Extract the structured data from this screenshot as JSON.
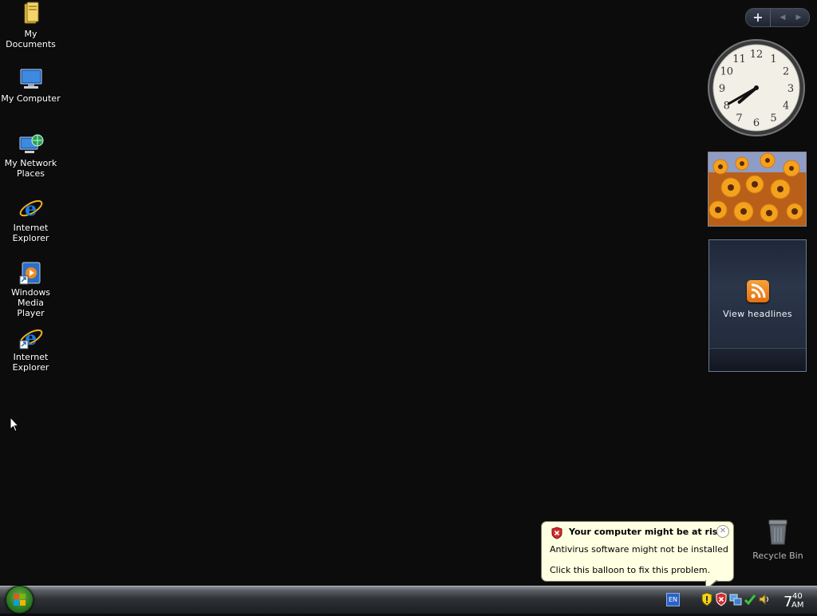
{
  "desktop_icons": [
    {
      "label_line1": "My Documents",
      "label_line2": "",
      "icon": "folder-icon"
    },
    {
      "label_line1": "My Computer",
      "label_line2": "",
      "icon": "computer-icon"
    },
    {
      "label_line1": "My Network",
      "label_line2": "Places",
      "icon": "network-places-icon"
    },
    {
      "label_line1": "Internet",
      "label_line2": "Explorer",
      "icon": "internet-explorer-icon"
    },
    {
      "label_line1": "Windows Media",
      "label_line2": "Player",
      "icon": "windows-media-player-icon"
    },
    {
      "label_line1": "Internet",
      "label_line2": "Explorer",
      "icon": "internet-explorer-shortcut-icon"
    }
  ],
  "sidebar": {
    "add_label": "+",
    "prev_label": "◀",
    "next_label": "▶",
    "clock": {
      "hour": 7,
      "minute": 40,
      "numerals": [
        "12",
        "1",
        "2",
        "3",
        "4",
        "5",
        "6",
        "7",
        "8",
        "9",
        "10",
        "11"
      ]
    },
    "slideshow": {
      "subject": "orange flowers"
    },
    "feed": {
      "label": "View headlines",
      "icon": "rss-icon"
    }
  },
  "recycle_bin": {
    "label": "Recycle Bin",
    "icon": "recycle-bin-icon"
  },
  "balloon": {
    "title": "Your computer might be at risk",
    "line1": "Antivirus software might not be installed",
    "line2": "Click this balloon to fix this problem.",
    "icon": "security-alert-shield-icon",
    "close": "✕"
  },
  "taskbar": {
    "language": "EN",
    "tray_icons": [
      "security-shield-yellow-icon",
      "security-alert-red-icon",
      "network-icon",
      "check-icon",
      "volume-icon"
    ],
    "time_hour": "7",
    "time_minute": "40",
    "time_ampm": "AM"
  },
  "colors": {
    "desktop_bg": "#0c0c0c",
    "balloon_bg": "#ffffe1",
    "start_orb": "#2f7d24"
  }
}
